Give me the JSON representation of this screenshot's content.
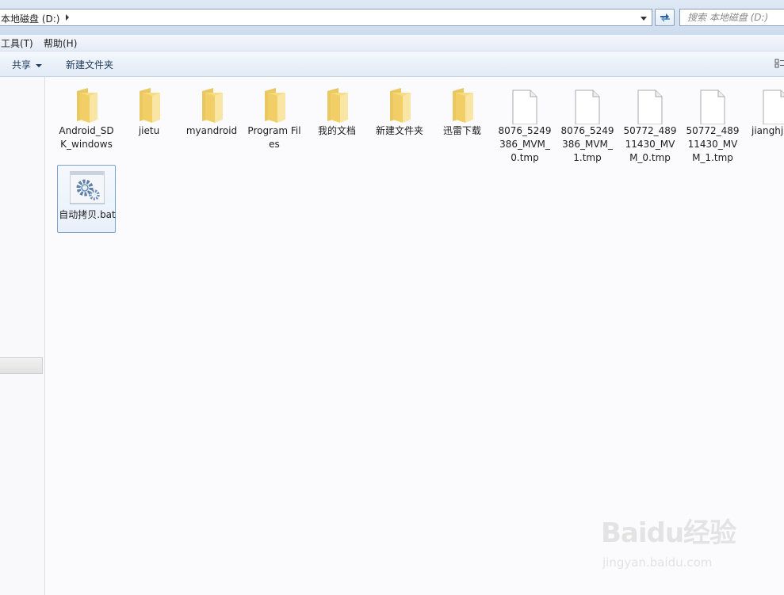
{
  "address_bar": {
    "path": "本地磁盘 (D:)"
  },
  "search": {
    "placeholder": "搜索 本地磁盘 (D:)"
  },
  "menu": {
    "items": [
      {
        "label": "工具(T)"
      },
      {
        "label": "帮助(H)"
      }
    ]
  },
  "toolbar": {
    "share_label": "共享",
    "new_folder_label": "新建文件夹"
  },
  "files": [
    {
      "name": "Android_SDK_windows",
      "type": "folder"
    },
    {
      "name": "jietu",
      "type": "folder"
    },
    {
      "name": "myandroid",
      "type": "folder"
    },
    {
      "name": "Program Files",
      "type": "folder"
    },
    {
      "name": "我的文档",
      "type": "folder"
    },
    {
      "name": "新建文件夹",
      "type": "folder"
    },
    {
      "name": "迅雷下载",
      "type": "folder"
    },
    {
      "name": "8076_5249386_MVM_0.tmp",
      "type": "file"
    },
    {
      "name": "8076_5249386_MVM_1.tmp",
      "type": "file"
    },
    {
      "name": "50772_48911430_MVM_0.tmp",
      "type": "file"
    },
    {
      "name": "50772_48911430_MVM_1.tmp",
      "type": "file"
    },
    {
      "name": "jianghj.",
      "type": "file"
    },
    {
      "name": "自动拷贝.bat",
      "type": "batch",
      "selected": true
    }
  ],
  "watermark": {
    "logo": "Baidu经验",
    "url": "jingyan.baidu.com"
  }
}
